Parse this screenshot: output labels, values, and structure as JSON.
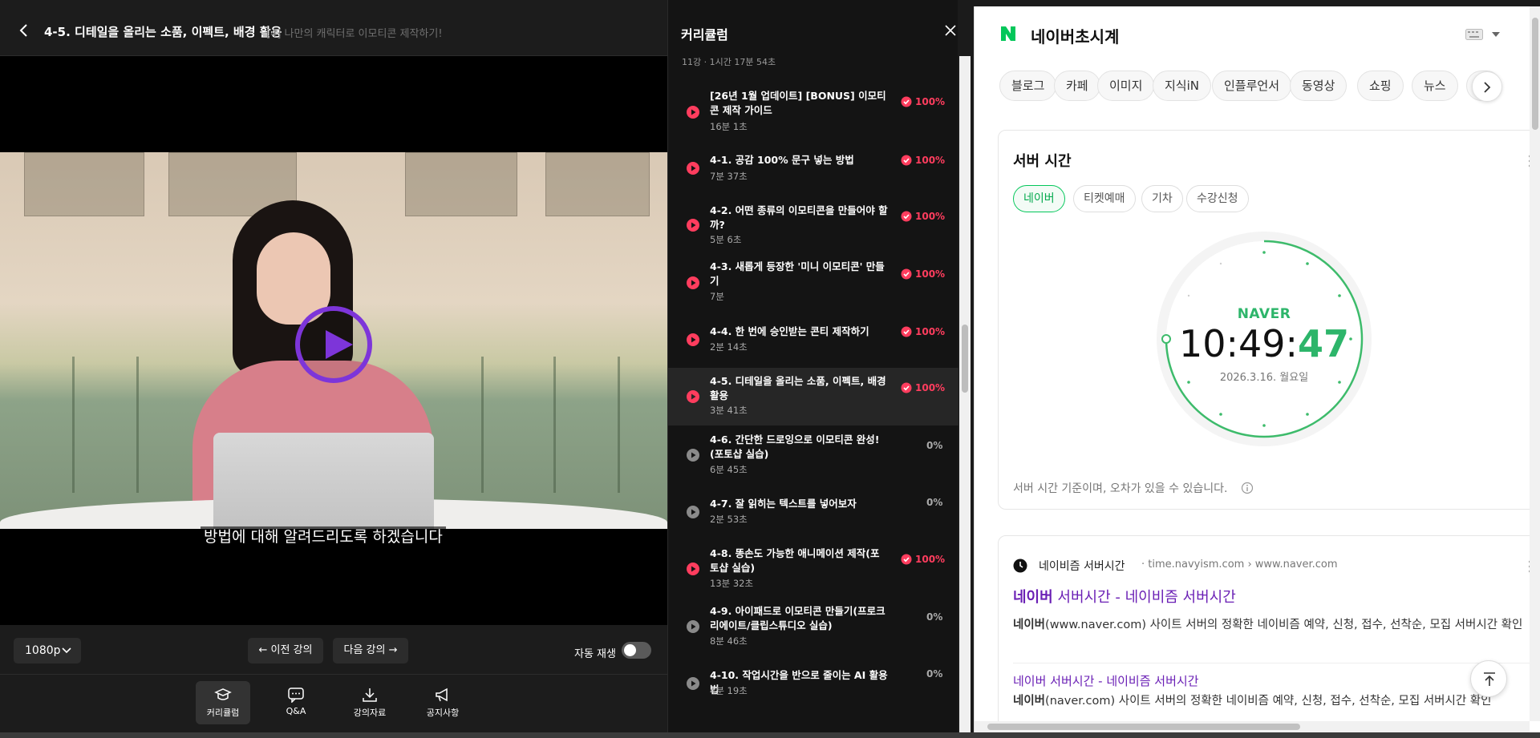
{
  "player": {
    "title": "4-5. 디테일을 올리는 소품, 이펙트, 배경 활용",
    "subtitle": "[4] 나만의 캐릭터로 이모티콘 제작하기!",
    "caption": "방법에 대해 알려드리도록 하겠습니다",
    "quality": "1080p",
    "prev_label": "← 이전 강의",
    "next_label": "다음 강의 →",
    "autoplay_label": "자동 재생",
    "autoplay_on": false,
    "tabs": [
      {
        "label": "커리큘럼",
        "icon": "graduation-cap-icon",
        "active": true
      },
      {
        "label": "Q&A",
        "icon": "chat-bubble-icon",
        "active": false
      },
      {
        "label": "강의자료",
        "icon": "download-icon",
        "active": false
      },
      {
        "label": "공지사항",
        "icon": "megaphone-icon",
        "active": false
      }
    ]
  },
  "curriculum": {
    "title": "커리큘럼",
    "summary": "11강 · 1시간 17분 54초",
    "lessons": [
      {
        "title": "[26년 1월 업데이트] [BONUS] 이모티콘 제작 가이드",
        "duration": "16분 1초",
        "progress": "100%",
        "done": true
      },
      {
        "title": "4-1. 공감 100% 문구 넣는 방법",
        "duration": "7분 37초",
        "progress": "100%",
        "done": true
      },
      {
        "title": "4-2. 어떤 종류의 이모티콘을 만들어야 할까?",
        "duration": "5분 6초",
        "progress": "100%",
        "done": true
      },
      {
        "title": "4-3. 새롭게 등장한 '미니 이모티콘' 만들기",
        "duration": "7분",
        "progress": "100%",
        "done": true
      },
      {
        "title": "4-4. 한 번에 승인받는 콘티 제작하기",
        "duration": "2분 14초",
        "progress": "100%",
        "done": true
      },
      {
        "title": "4-5. 디테일을 올리는 소품, 이펙트, 배경 활용",
        "duration": "3분 41초",
        "progress": "100%",
        "done": true,
        "current": true
      },
      {
        "title": "4-6. 간단한 드로잉으로 이모티콘 완성!(포토샵 실습)",
        "duration": "6분 45초",
        "progress": "0%",
        "done": false
      },
      {
        "title": "4-7. 잘 읽히는 텍스트를 넣어보자",
        "duration": "2분 53초",
        "progress": "0%",
        "done": false
      },
      {
        "title": "4-8. 똥손도 가능한 애니메이션 제작(포토샵 실습)",
        "duration": "13분 32초",
        "progress": "100%",
        "done": true
      },
      {
        "title": "4-9. 아이패드로 이모티콘 만들기(프로크리에이트/클립스튜디오 실습)",
        "duration": "8분 46초",
        "progress": "0%",
        "done": false
      },
      {
        "title": "4-10. 작업시간을 반으로 줄이는 AI 활용법",
        "duration": "4분 19초",
        "progress": "0%",
        "done": false
      }
    ]
  },
  "browser": {
    "query": "네이버초시계",
    "chips": [
      "블로그",
      "카페",
      "이미지",
      "지식iN",
      "인플루언서",
      "동영상",
      "쇼핑",
      "뉴스",
      "지"
    ],
    "time_card": {
      "title": "서버 시간",
      "tabs": [
        "네이버",
        "티켓예매",
        "기차",
        "수강신청"
      ],
      "active_tab": "네이버",
      "brand": "NAVER",
      "time_hm": "10:49:",
      "time_s": "47",
      "date": "2026.3.16. 월요일",
      "note": "서버 시간 기준이며, 오차가 있을 수 있습니다."
    },
    "result": {
      "site_name": "네이비즘 서버시간",
      "site_url": "· time.navyism.com › www.naver.com",
      "link_prefix": "네이버",
      "link_rest": " 서버시간 - 네이비즘 서버시간",
      "desc_bold": "네이버",
      "desc_rest": "(www.naver.com) 사이트 서버의 정확한 네이비즘 예약, 신청, 접수, 선착순, 모집 서버시간 확인",
      "link2": "네이버 서버시간 - 네이비즘 서버시간",
      "desc2_bold": "네이버",
      "desc2_rest": "(naver.com) 사이트 서버의 정확한 네이비즘 예약, 신청, 접수, 선착순, 모집 서버시간 확인"
    }
  },
  "colors": {
    "accent_purple": "#7d35d9",
    "progress_red": "#ff3d5e",
    "naver_green": "#03c75a",
    "link_purple": "#6a1fb5"
  }
}
